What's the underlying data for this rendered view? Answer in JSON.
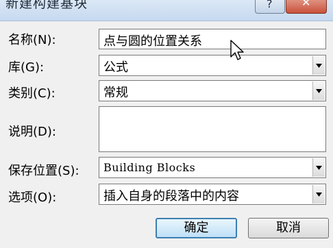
{
  "dialog": {
    "title": "新建构建基块",
    "help_label": "?",
    "close_label": "✕"
  },
  "form": {
    "name": {
      "label": "名称(N):",
      "value": "点与圆的位置关系"
    },
    "gallery": {
      "label": "库(G):",
      "value": "公式"
    },
    "category": {
      "label": "类别(C):",
      "value": "常规"
    },
    "description": {
      "label": "说明(D):",
      "value": ""
    },
    "save_in": {
      "label": "保存位置(S):",
      "value": "Building Blocks"
    },
    "options": {
      "label": "选项(O):",
      "value": "插入自身的段落中的内容"
    }
  },
  "buttons": {
    "ok_label": "确定",
    "cancel_label": "取消"
  },
  "icons": {
    "dropdown": "chevron-down-icon",
    "cursor": "mouse-pointer-icon"
  }
}
